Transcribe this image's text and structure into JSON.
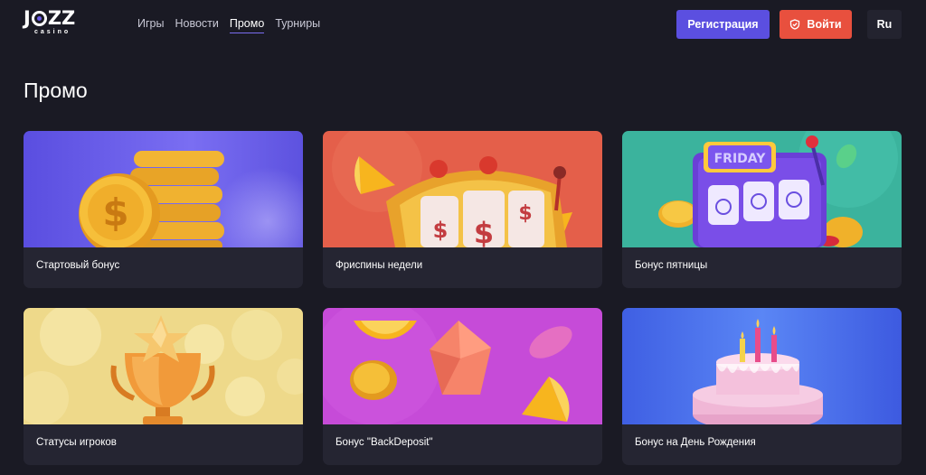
{
  "header": {
    "logo_text": "JOZZ",
    "logo_sub": "casino",
    "nav": [
      {
        "label": "Игры"
      },
      {
        "label": "Новости"
      },
      {
        "label": "Промо",
        "active": true
      },
      {
        "label": "Турниры"
      }
    ],
    "register_label": "Регистрация",
    "login_label": "Войти",
    "lang_label": "Ru"
  },
  "colors": {
    "background": "#1a1a24",
    "register": "#5b4fe0",
    "login": "#e8503e",
    "card": "#252532"
  },
  "page": {
    "title": "Промо"
  },
  "promos": [
    {
      "title": "Стартовый бонус",
      "art": "gold-coins"
    },
    {
      "title": "Фриспины недели",
      "art": "slot-machine-red"
    },
    {
      "title": "Бонус пятницы",
      "art": "friday-slot"
    },
    {
      "title": "Статусы игроков",
      "art": "trophy-star"
    },
    {
      "title": "Бонус \"BackDeposit\"",
      "art": "gem-lemons"
    },
    {
      "title": "Бонус на День Рождения",
      "art": "birthday-cake"
    }
  ],
  "art_text": {
    "friday": "FRIDAY"
  }
}
